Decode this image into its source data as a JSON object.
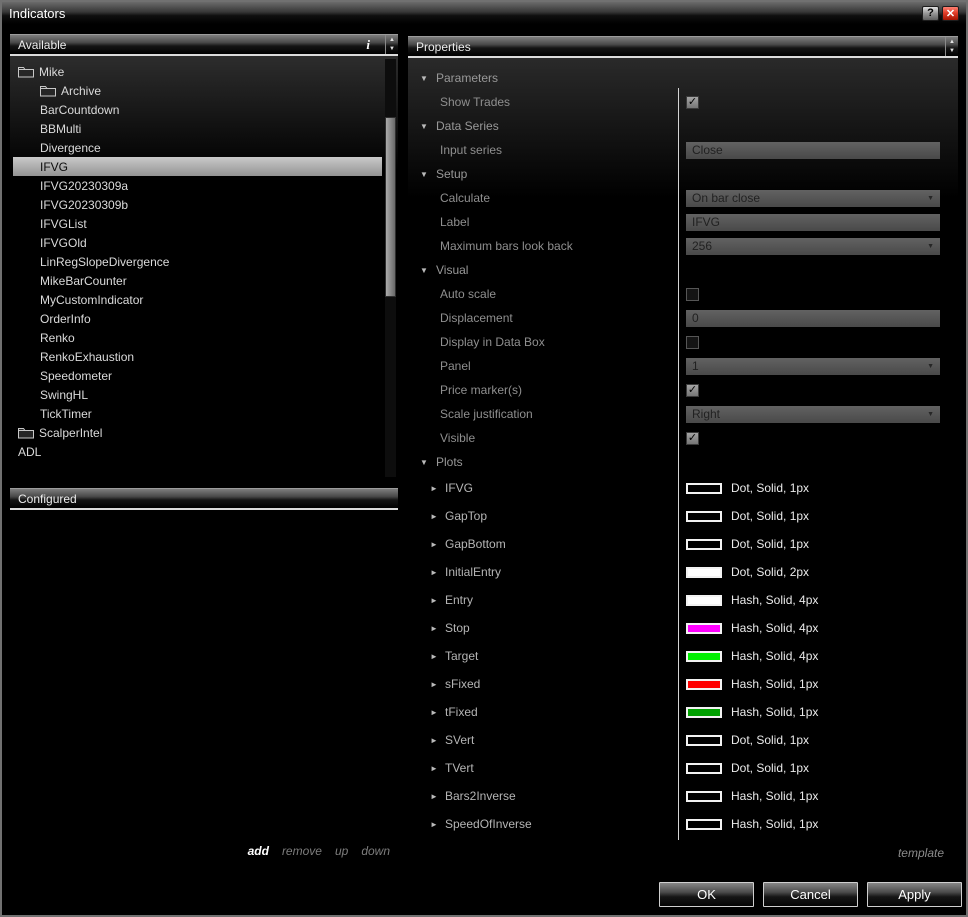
{
  "window": {
    "title": "Indicators",
    "help_button": "?"
  },
  "icons": {
    "close": "✕",
    "scroll_up": "▲",
    "scroll_down": "▼",
    "section_expanded": "▼",
    "plot_collapsed": "►",
    "checkmark": "✓",
    "dropdown_chevron": "▼"
  },
  "available_panel": {
    "header": "Available",
    "info_icon": "i",
    "selected_item": "IFVG",
    "tree": [
      {
        "label": "Mike",
        "type": "folder",
        "level": 0
      },
      {
        "label": "Archive",
        "type": "folder",
        "level": 1
      },
      {
        "label": "BarCountdown",
        "type": "indicator",
        "level": 1
      },
      {
        "label": "BBMulti",
        "type": "indicator",
        "level": 1
      },
      {
        "label": "Divergence",
        "type": "indicator",
        "level": 1
      },
      {
        "label": "IFVG",
        "type": "indicator",
        "level": 1
      },
      {
        "label": "IFVG20230309a",
        "type": "indicator",
        "level": 1
      },
      {
        "label": "IFVG20230309b",
        "type": "indicator",
        "level": 1
      },
      {
        "label": "IFVGList",
        "type": "indicator",
        "level": 1
      },
      {
        "label": "IFVGOld",
        "type": "indicator",
        "level": 1
      },
      {
        "label": "LinRegSlopeDivergence",
        "type": "indicator",
        "level": 1
      },
      {
        "label": "MikeBarCounter",
        "type": "indicator",
        "level": 1
      },
      {
        "label": "MyCustomIndicator",
        "type": "indicator",
        "level": 1
      },
      {
        "label": "OrderInfo",
        "type": "indicator",
        "level": 1
      },
      {
        "label": "Renko",
        "type": "indicator",
        "level": 1
      },
      {
        "label": "RenkoExhaustion",
        "type": "indicator",
        "level": 1
      },
      {
        "label": "Speedometer",
        "type": "indicator",
        "level": 1
      },
      {
        "label": "SwingHL",
        "type": "indicator",
        "level": 1
      },
      {
        "label": "TickTimer",
        "type": "indicator",
        "level": 1
      },
      {
        "label": "ScalperIntel",
        "type": "folder",
        "level": 0
      },
      {
        "label": "ADL",
        "type": "indicator",
        "level": 0
      }
    ]
  },
  "configured_panel": {
    "header": "Configured",
    "actions": [
      {
        "label": "add",
        "emphasis": true
      },
      {
        "label": "remove",
        "emphasis": false
      },
      {
        "label": "up",
        "emphasis": false
      },
      {
        "label": "down",
        "emphasis": false
      }
    ]
  },
  "properties_panel": {
    "header": "Properties",
    "template_link": "template",
    "sections": [
      {
        "label": "Parameters",
        "rows": [
          {
            "label": "Show Trades",
            "control": "checkbox",
            "checked": true
          }
        ]
      },
      {
        "label": "Data Series",
        "rows": [
          {
            "label": "Input series",
            "control": "textbox",
            "value": "Close"
          }
        ]
      },
      {
        "label": "Setup",
        "rows": [
          {
            "label": "Calculate",
            "control": "dropdown",
            "value": "On bar close"
          },
          {
            "label": "Label",
            "control": "textbox",
            "value": "IFVG"
          },
          {
            "label": "Maximum bars look back",
            "control": "dropdown",
            "value": "256"
          }
        ]
      },
      {
        "label": "Visual",
        "rows": [
          {
            "label": "Auto scale",
            "control": "checkbox",
            "checked": false
          },
          {
            "label": "Displacement",
            "control": "textbox",
            "value": "0"
          },
          {
            "label": "Display in Data Box",
            "control": "checkbox",
            "checked": false
          },
          {
            "label": "Panel",
            "control": "dropdown",
            "value": "1"
          },
          {
            "label": "Price marker(s)",
            "control": "checkbox",
            "checked": true
          },
          {
            "label": "Scale justification",
            "control": "dropdown",
            "value": "Right"
          },
          {
            "label": "Visible",
            "control": "checkbox",
            "checked": true
          }
        ]
      },
      {
        "label": "Plots",
        "plots": [
          {
            "label": "IFVG",
            "swatch": "#000000",
            "style": "Dot, Solid, 1px"
          },
          {
            "label": "GapTop",
            "swatch": "#000000",
            "style": "Dot, Solid, 1px"
          },
          {
            "label": "GapBottom",
            "swatch": "#000000",
            "style": "Dot, Solid, 1px"
          },
          {
            "label": "InitialEntry",
            "swatch": "#ffffff",
            "style": "Dot, Solid, 2px"
          },
          {
            "label": "Entry",
            "swatch": "#ffffff",
            "style": "Hash, Solid, 4px"
          },
          {
            "label": "Stop",
            "swatch": "#ff00ff",
            "style": "Hash, Solid, 4px"
          },
          {
            "label": "Target",
            "swatch": "#00ef00",
            "style": "Hash, Solid, 4px"
          },
          {
            "label": "sFixed",
            "swatch": "#ff0000",
            "style": "Hash, Solid, 1px"
          },
          {
            "label": "tFixed",
            "swatch": "#00a000",
            "style": "Hash, Solid, 1px"
          },
          {
            "label": "SVert",
            "swatch": "#000000",
            "style": "Dot, Solid, 1px"
          },
          {
            "label": "TVert",
            "swatch": "#000000",
            "style": "Dot, Solid, 1px"
          },
          {
            "label": "Bars2Inverse",
            "swatch": "#000000",
            "style": "Hash, Solid, 1px"
          },
          {
            "label": "SpeedOfInverse",
            "swatch": "#000000",
            "style": "Hash, Solid, 1px"
          }
        ]
      }
    ]
  },
  "footer": {
    "ok_button": "OK",
    "cancel_button": "Cancel",
    "apply_button": "Apply"
  }
}
